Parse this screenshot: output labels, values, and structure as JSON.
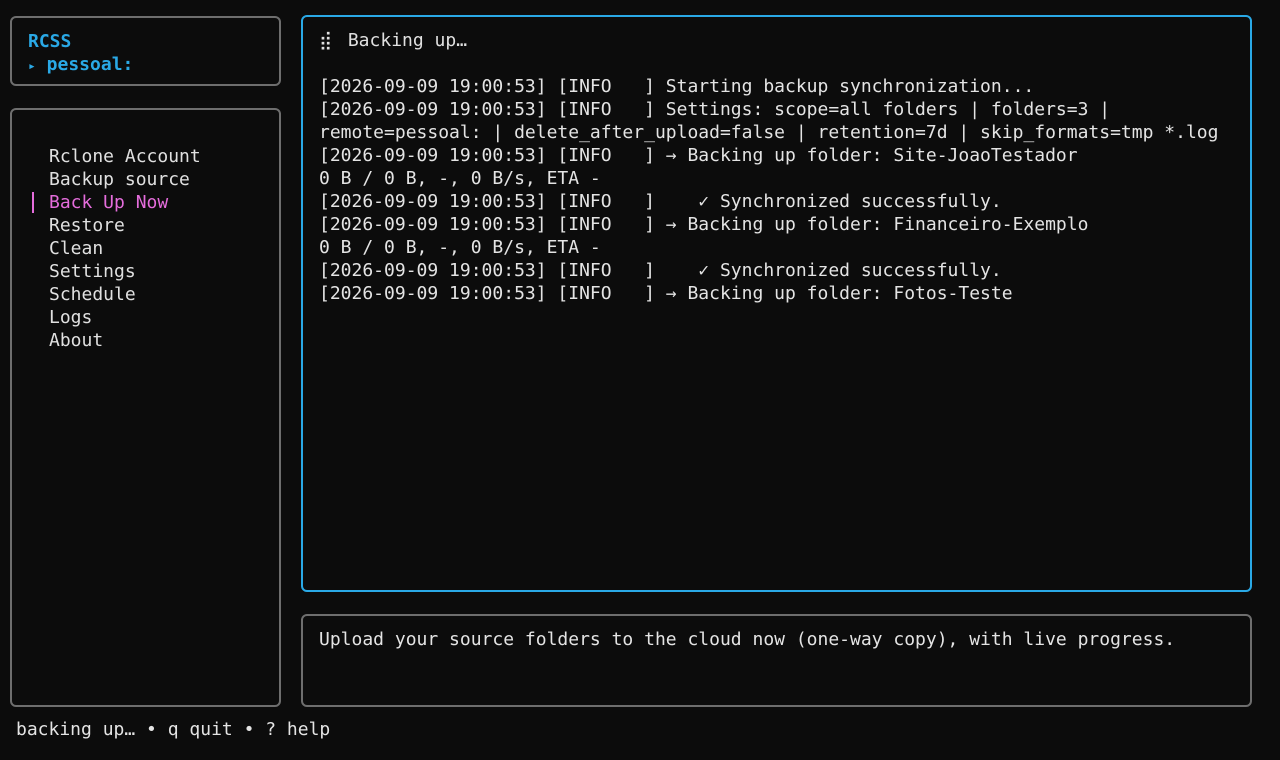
{
  "brand": {
    "title": "RCSS",
    "remote_marker": "▸",
    "remote": "pessoal:"
  },
  "menu": {
    "items": [
      {
        "label": "Rclone Account",
        "active": false
      },
      {
        "label": "Backup source",
        "active": false
      },
      {
        "label": "Back Up Now",
        "active": true
      },
      {
        "label": "Restore",
        "active": false
      },
      {
        "label": "Clean",
        "active": false
      },
      {
        "label": "Settings",
        "active": false
      },
      {
        "label": "Schedule",
        "active": false
      },
      {
        "label": "Logs",
        "active": false
      },
      {
        "label": "About",
        "active": false
      }
    ]
  },
  "log_panel": {
    "spinner": "⣾",
    "title": "Backing up…",
    "lines": [
      "[2026-09-09 19:00:53] [INFO   ] Starting backup synchronization...",
      "[2026-09-09 19:00:53] [INFO   ] Settings: scope=all folders | folders=3 |",
      "remote=pessoal: | delete_after_upload=false | retention=7d | skip_formats=tmp *.log",
      "[2026-09-09 19:00:53] [INFO   ] → Backing up folder: Site-JoaoTestador",
      "0 B / 0 B, -, 0 B/s, ETA -",
      "[2026-09-09 19:00:53] [INFO   ]    ✓ Synchronized successfully.",
      "[2026-09-09 19:00:53] [INFO   ] → Backing up folder: Financeiro-Exemplo",
      "0 B / 0 B, -, 0 B/s, ETA -",
      "[2026-09-09 19:00:53] [INFO   ]    ✓ Synchronized successfully.",
      "[2026-09-09 19:00:53] [INFO   ] → Backing up folder: Fotos-Teste"
    ]
  },
  "description": {
    "text": "Upload your source folders to the cloud now (one-way copy), with live progress."
  },
  "status_bar": {
    "text": "backing up… • q quit • ? help"
  },
  "colors": {
    "accent": "#2aa9e6",
    "active_item": "#e56ddc",
    "border": "#6e6e6e",
    "background": "#0c0c0c"
  }
}
